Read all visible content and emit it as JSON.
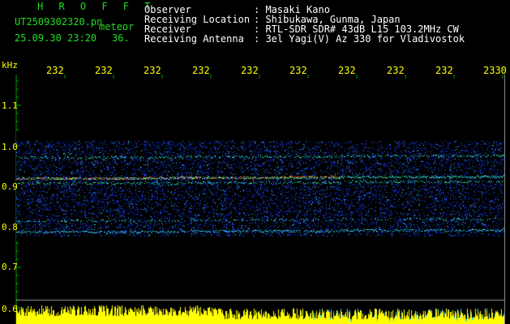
{
  "header": {
    "title": "H R O F F T",
    "filename": "UT2509302320.pn",
    "meteor_label": "meteor",
    "datetime": "25.09.30 23:20",
    "count": "36."
  },
  "info": [
    {
      "label": "Observer",
      "value": ": Masaki Kano"
    },
    {
      "label": "Receiving Location",
      "value": ": Shibukawa, Gunma, Japan"
    },
    {
      "label": "Receiver",
      "value": ": RTL-SDR SDR# 43dB L15 103.2MHz CW"
    },
    {
      "label": "Receiving Antenna",
      "value": ": 3el Yagi(V) Az 330 for Vladivostok"
    }
  ],
  "axis": {
    "unit": "kHz",
    "time_ticks": [
      "232",
      "232",
      "232",
      "232",
      "232",
      "232",
      "232",
      "232",
      "232",
      "2330"
    ],
    "freq_ticks": [
      "1.1",
      "1.0",
      "0.9",
      "0.8",
      "0.7",
      "0.6"
    ]
  },
  "colors": {
    "text_green": "#22dd22",
    "text_white": "#ffffff",
    "axis_yellow": "#ffff00",
    "grid_green": "#009900",
    "noise_blue": "#1a3cff",
    "signal_cyan": "#33ffcc",
    "signal_red": "#ff2060"
  }
}
